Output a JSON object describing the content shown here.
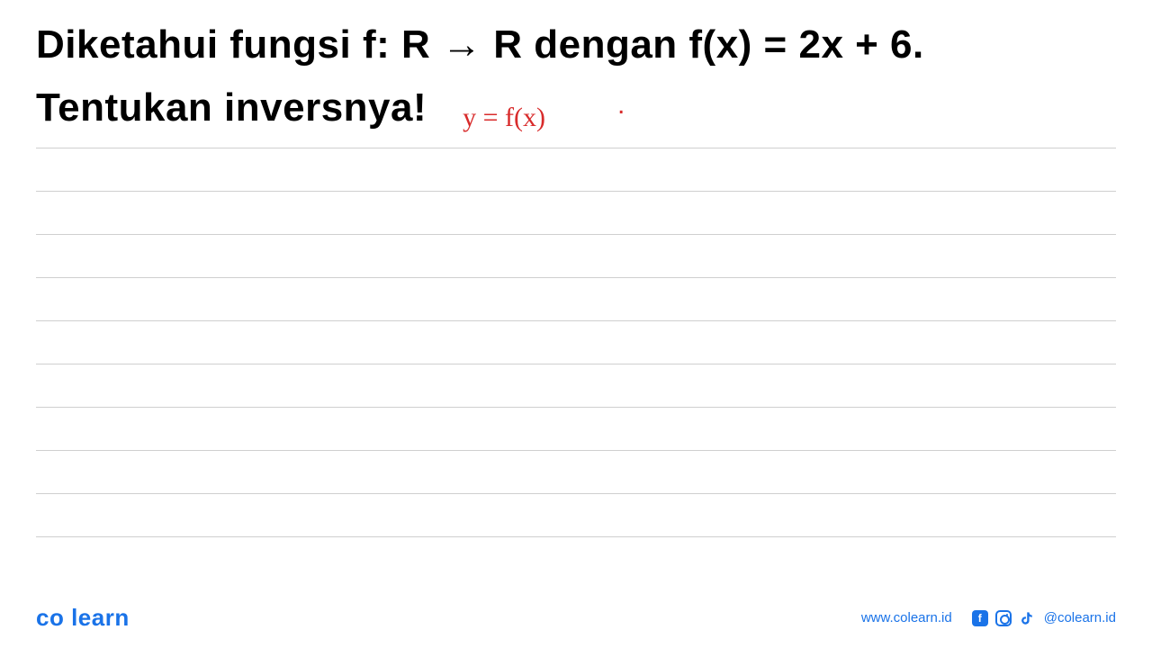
{
  "problem": {
    "line1": "Diketahui fungsi f: R → R dengan f(x) = 2x + 6.",
    "line2": "Tentukan inversnya!"
  },
  "handwriting": {
    "note1": "y = f(x)"
  },
  "footer": {
    "brand": "co learn",
    "website": "www.colearn.id",
    "handle": "@colearn.id",
    "icons": {
      "facebook": "f",
      "instagram": "instagram-icon",
      "tiktok": "tiktok-icon"
    }
  }
}
